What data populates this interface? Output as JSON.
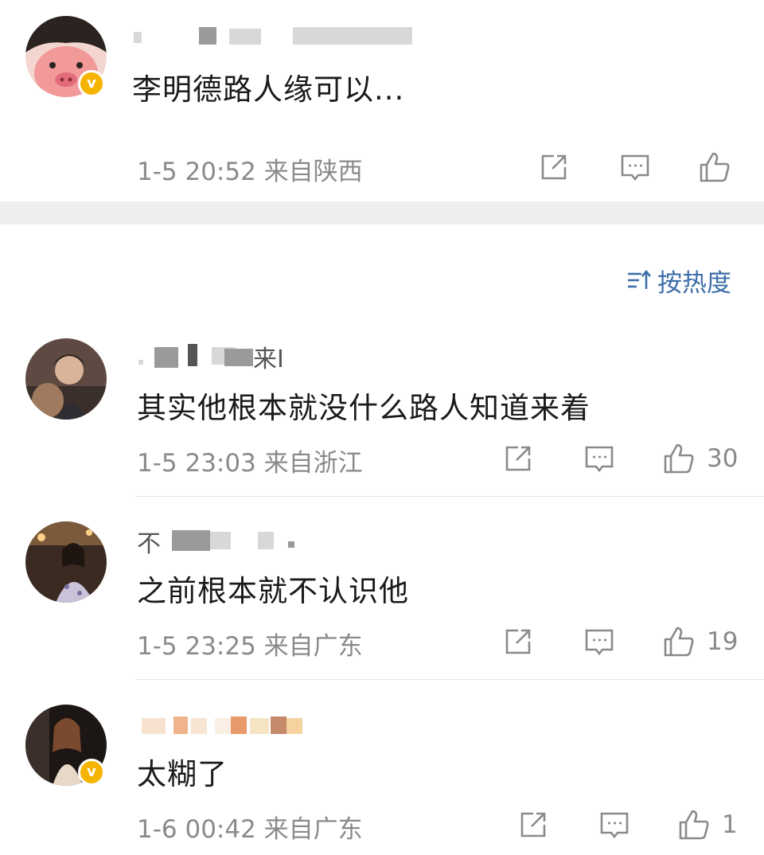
{
  "comments_top": {
    "content": "李明德路人缘可以...",
    "meta": "1-5 20:52 来自陕西"
  },
  "sort": {
    "label": "按热度",
    "icon": "sort-icon"
  },
  "comments": [
    {
      "user_fragment": "来I",
      "content": "其实他根本就没什么路人知道来着",
      "meta": "1-5 23:03 来自浙江",
      "likes": "30"
    },
    {
      "user_fragment": "不",
      "content": "之前根本就不认识他",
      "meta": "1-5 23:25 来自广东",
      "likes": "19"
    },
    {
      "user_fragment": "",
      "content": "太糊了",
      "meta": "1-6 00:42 来自广东",
      "likes": "1"
    }
  ],
  "icons": {
    "share": "share-icon",
    "comment": "comment-icon",
    "like": "thumbs-up-icon",
    "verified": "verified-badge-icon"
  },
  "colors": {
    "badge": "#f5b400",
    "sort_accent": "#3d6ea8",
    "meta_text": "#8a8a8a",
    "section_gap": "#eeeeee"
  }
}
